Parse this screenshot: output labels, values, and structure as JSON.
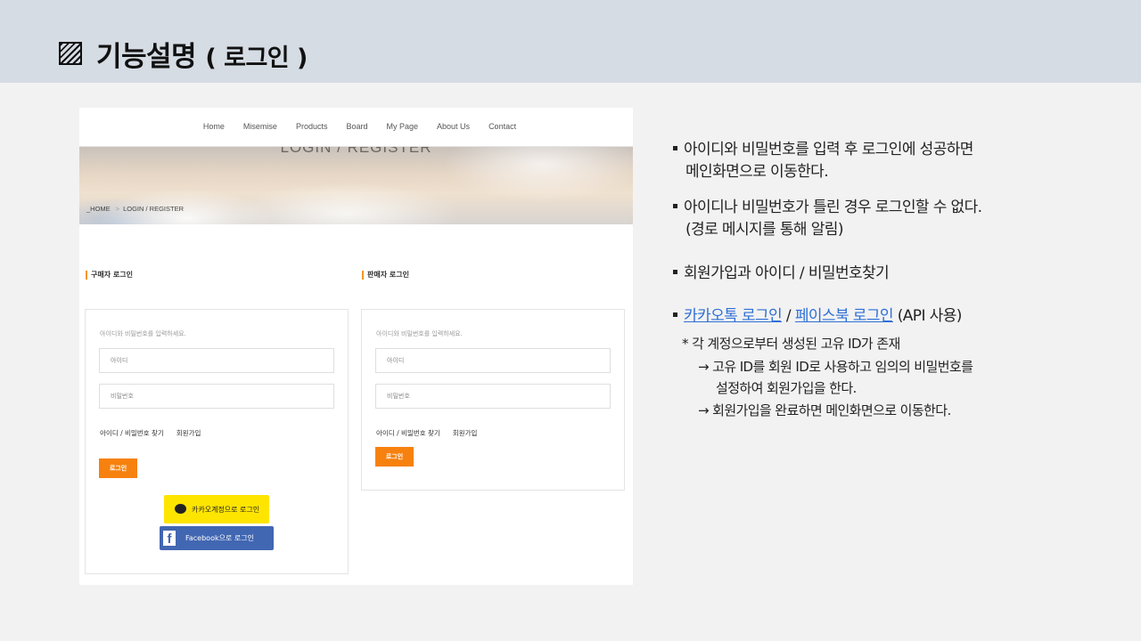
{
  "slide": {
    "title_main": "기능설명",
    "title_sub": "( 로그인 )",
    "title_icon": "hatched-square-icon"
  },
  "site": {
    "nav": [
      "Home",
      "Misemise",
      "Products",
      "Board",
      "My Page",
      "About Us",
      "Contact"
    ],
    "banner_title": "LOGIN / REGISTER",
    "breadcrumb": [
      "_HOME",
      "LOGIN / REGISTER"
    ],
    "buyer": {
      "section_label": "구매자 로그인",
      "hint": "아이디와 비밀번호를 입력하세요.",
      "id_placeholder": "아이디",
      "pw_placeholder": "비밀번호",
      "find_link": "아이디 / 비밀번호 찾기",
      "join_link": "회원가입",
      "login_button": "로그인",
      "kakao_button": "카카오계정으로 로그인",
      "facebook_button": "Facebook으로 로그인"
    },
    "seller": {
      "section_label": "판매자 로그인",
      "hint": "아이디와 비밀번호를 입력하세요.",
      "id_placeholder": "아이디",
      "pw_placeholder": "비밀번호",
      "find_link": "아이디 / 비밀번호 찾기",
      "join_link": "회원가입",
      "login_button": "로그인"
    },
    "colors": {
      "accent": "#f7810f",
      "kakao": "#fee500",
      "facebook": "#4267b2"
    }
  },
  "description": {
    "b1_l1": "아이디와 비밀번호를 입력 후 로그인에 성공하면",
    "b1_l2": "메인화면으로 이동한다.",
    "b2_l1": "아이디나 비밀번호가 틀린 경우 로그인할 수 없다.",
    "b2_l2": "(경로 메시지를 통해 알림)",
    "b3": "회원가입과 아이디 / 비밀번호찾기",
    "b4_kakao": "카카오톡 로그인",
    "b4_sep": " / ",
    "b4_facebook": "페이스북 로그인",
    "b4_tail": " (API 사용)",
    "note1": "* 각 계정으로부터 생성된 고유 ID가 존재",
    "note2_l1": "→ 고유 ID를 회원 ID로 사용하고 임의의 비밀번호를",
    "note2_l2": "설정하여 회원가입을 한다.",
    "note3": "→ 회원가입을 완료하면 메인화면으로 이동한다."
  }
}
